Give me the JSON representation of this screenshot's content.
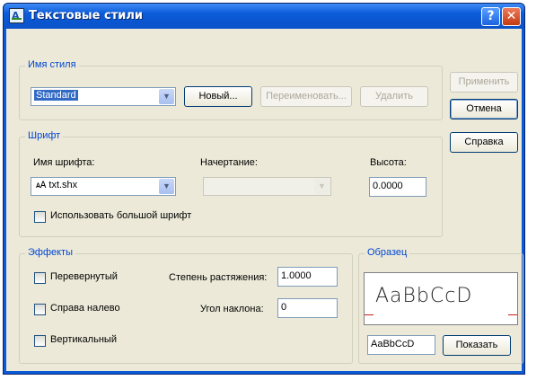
{
  "window": {
    "title": "Текстовые стили",
    "help_glyph": "?",
    "close_glyph": "✕",
    "icon_glyph": "A"
  },
  "style_name": {
    "group_label": "Имя стиля",
    "selected": "Standard",
    "new_button": "Новый...",
    "rename_button": "Переименовать...",
    "delete_button": "Удалить"
  },
  "side_buttons": {
    "apply": "Применить",
    "cancel": "Отмена",
    "help": "Справка"
  },
  "font": {
    "group_label": "Шрифт",
    "font_name_label": "Имя шрифта:",
    "font_name_value": "txt.shx",
    "style_label": "Начертание:",
    "style_value": "",
    "height_label": "Высота:",
    "height_value": "0.0000",
    "bigfont_label": "Использовать большой шрифт",
    "bigfont_checked": false
  },
  "effects": {
    "group_label": "Эффекты",
    "upside_down_label": "Перевернутый",
    "upside_down_checked": false,
    "backwards_label": "Справа налево",
    "backwards_checked": false,
    "vertical_label": "Вертикальный",
    "vertical_checked": false,
    "width_factor_label": "Степень растяжения:",
    "width_factor_value": "1.0000",
    "oblique_label": "Угол наклона:",
    "oblique_value": "0"
  },
  "preview": {
    "group_label": "Образец",
    "sample_text": "AaBbCcD",
    "input_value": "AaBbCcD",
    "show_button": "Показать"
  },
  "colors": {
    "title_bar": "#0b5bd8",
    "dialog_bg": "#ece9d8",
    "group_label": "#0046d5",
    "preview_line": "#c02020"
  }
}
